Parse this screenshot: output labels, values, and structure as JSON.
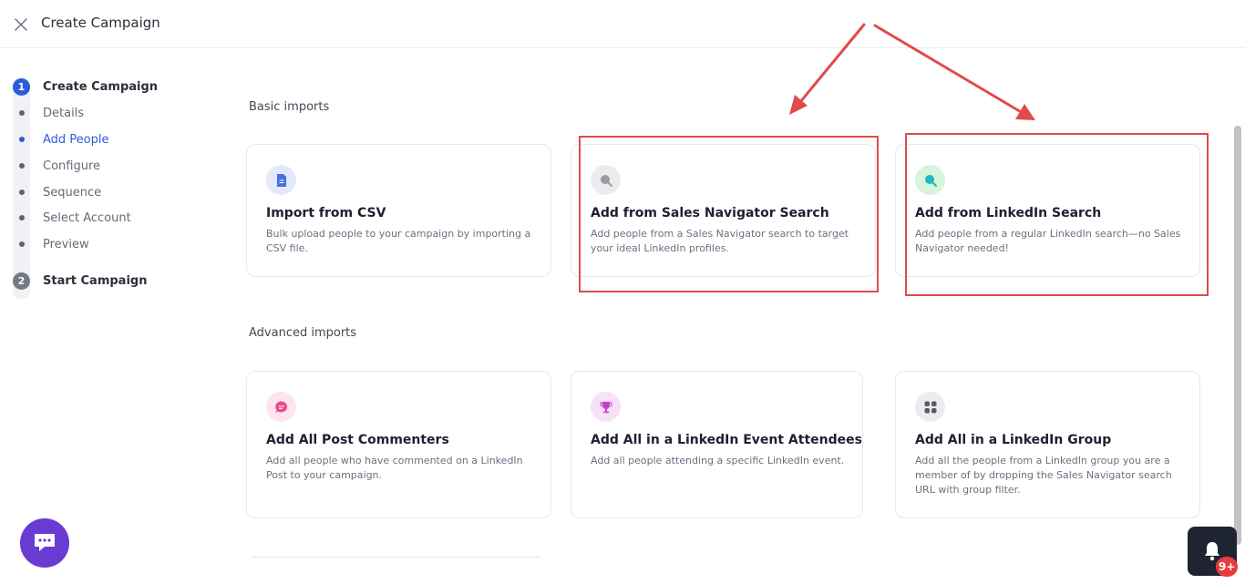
{
  "header": {
    "title": "Create Campaign"
  },
  "stepper": {
    "step1": {
      "num": "1",
      "label": "Create Campaign"
    },
    "substeps": [
      {
        "label": "Details"
      },
      {
        "label": "Add People",
        "active": true
      },
      {
        "label": "Configure"
      },
      {
        "label": "Sequence"
      },
      {
        "label": "Select Account"
      },
      {
        "label": "Preview"
      }
    ],
    "step2": {
      "num": "2",
      "label": "Start Campaign"
    }
  },
  "basic": {
    "title": "Basic imports",
    "cards": [
      {
        "title": "Import from CSV",
        "desc": "Bulk upload people to your campaign by importing a CSV file.",
        "icon": "csv-file-icon"
      },
      {
        "title": "Add from Sales Navigator Search",
        "desc": "Add people from a Sales Navigator search to target your ideal LinkedIn profiles.",
        "icon": "sales-navigator-search-icon"
      },
      {
        "title": "Add from LinkedIn Search",
        "desc": "Add people from a regular LinkedIn search—no Sales Navigator needed!",
        "icon": "linkedin-search-icon"
      }
    ]
  },
  "advanced": {
    "title": "Advanced imports",
    "cards": [
      {
        "title": "Add All Post Commenters",
        "desc": "Add all people who have commented on a LinkedIn Post to your campaign.",
        "icon": "comment-icon"
      },
      {
        "title": "Add All in a LinkedIn Event Attendees",
        "desc": "Add all people attending a specific LinkedIn event.",
        "icon": "trophy-icon"
      },
      {
        "title": "Add All in a LinkedIn Group",
        "desc": "Add all the people from a LinkedIn group you are a member of by dropping the Sales Navigator search URL with group filter.",
        "icon": "group-grid-icon"
      }
    ]
  },
  "notifications": {
    "badge": "9+"
  },
  "colors": {
    "accent": "#2e5bd8",
    "highlight": "#e04a4a",
    "chat": "#6a3bd1"
  }
}
